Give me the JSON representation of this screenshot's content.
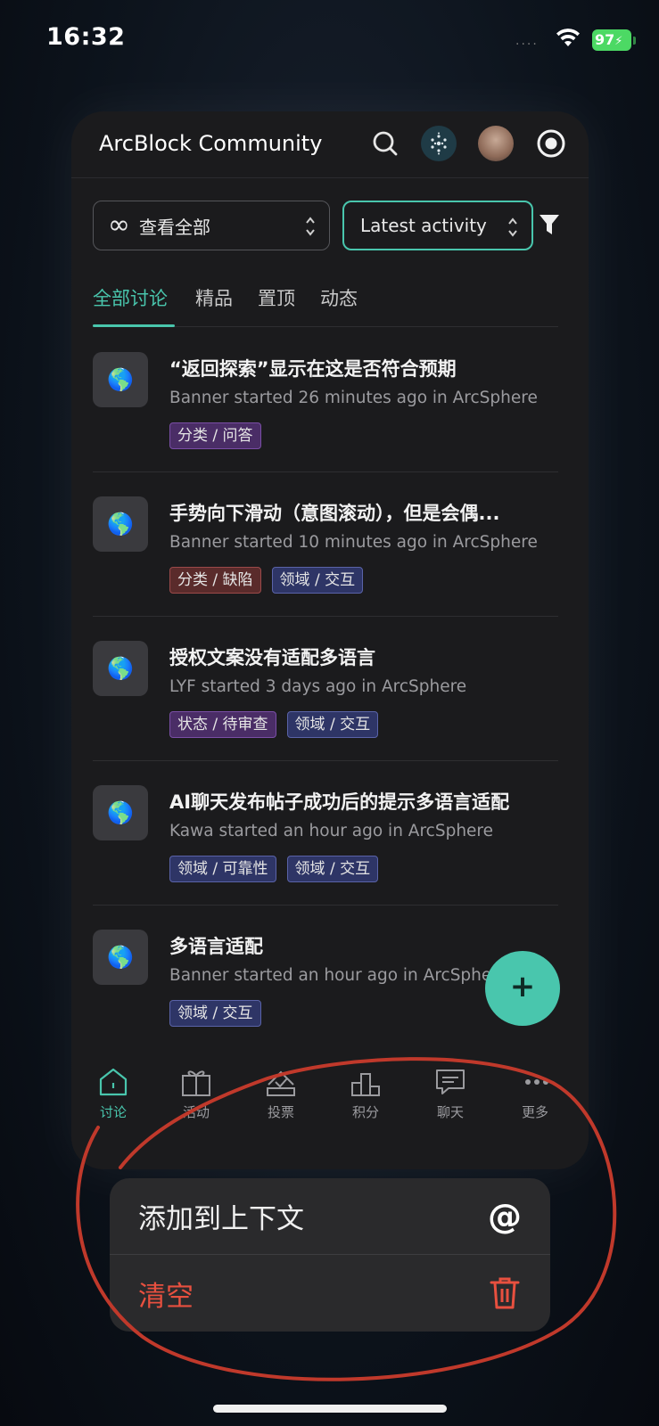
{
  "status_bar": {
    "time": "16:32",
    "battery": "97",
    "signal": "....",
    "battery_color": "#4cd964"
  },
  "app": {
    "title": "ArcBlock Community",
    "accent_color": "#49c6ad",
    "header_icons": [
      "search-icon",
      "dapp-icon",
      "avatar",
      "target-icon"
    ]
  },
  "filters": {
    "scope_label": "查看全部",
    "scope_icon": "infinity-icon",
    "sort_label": "Latest activity",
    "filter_icon": "funnel-icon"
  },
  "tabs": [
    {
      "label": "全部讨论",
      "active": true
    },
    {
      "label": "精品",
      "active": false
    },
    {
      "label": "置顶",
      "active": false
    },
    {
      "label": "动态",
      "active": false
    }
  ],
  "topics": [
    {
      "icon": "🌎",
      "title": "“返回探索”显示在这是否符合预期",
      "meta": "Banner started 26 minutes ago in ArcSphere",
      "tags": [
        {
          "label": "分类 / 问答",
          "color": "purple"
        }
      ]
    },
    {
      "icon": "🌎",
      "title": "手势向下滑动（意图滚动），但是会偶...",
      "meta": "Banner started 10 minutes ago in ArcSphere",
      "tags": [
        {
          "label": "分类 / 缺陷",
          "color": "red"
        },
        {
          "label": "领域 / 交互",
          "color": "blue"
        }
      ]
    },
    {
      "icon": "🌎",
      "title": "授权文案没有适配多语言",
      "meta": "LYF started 3 days ago in ArcSphere",
      "tags": [
        {
          "label": "状态 / 待审查",
          "color": "purple"
        },
        {
          "label": "领域 / 交互",
          "color": "blue"
        }
      ]
    },
    {
      "icon": "🌎",
      "title": "AI聊天发布帖子成功后的提示多语言适配",
      "meta": "Kawa started an hour ago in ArcSphere",
      "tags": [
        {
          "label": "领域 / 可靠性",
          "color": "blue"
        },
        {
          "label": "领域 / 交互",
          "color": "blue"
        }
      ]
    },
    {
      "icon": "🌎",
      "title": "多语言适配",
      "meta": "Banner started an hour ago in ArcSphe",
      "tags": [
        {
          "label": "领域 / 交互",
          "color": "blue"
        }
      ]
    }
  ],
  "fab_label": "+",
  "bottom_nav": [
    {
      "label": "讨论",
      "icon": "home-icon",
      "active": true
    },
    {
      "label": "活动",
      "icon": "gift-icon",
      "active": false
    },
    {
      "label": "投票",
      "icon": "vote-icon",
      "active": false
    },
    {
      "label": "积分",
      "icon": "podium-icon",
      "active": false
    },
    {
      "label": "聊天",
      "icon": "chat-icon",
      "active": false
    },
    {
      "label": "更多",
      "icon": "more-icon",
      "active": false
    }
  ],
  "context_menu": {
    "add_label": "添加到上下文",
    "add_icon": "@",
    "clear_label": "清空",
    "clear_icon": "trash-icon",
    "clear_color": "#e8503f"
  },
  "annotation_color": "#c0392b"
}
